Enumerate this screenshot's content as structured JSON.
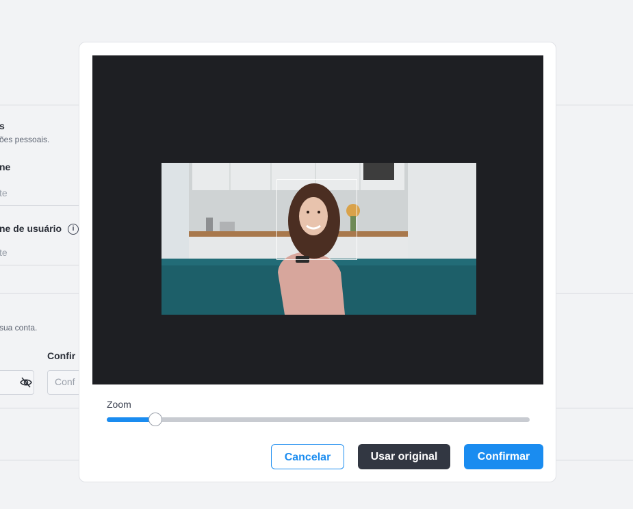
{
  "background": {
    "section1": {
      "title": "s",
      "subtitle": "ões pessoais."
    },
    "name_field": {
      "label": "ne",
      "value": "te"
    },
    "username_field": {
      "label": "ne de usuário",
      "value": "te",
      "info_icon": "i"
    },
    "section2": {
      "subtitle": "sua conta."
    },
    "confirm_field": {
      "label": "Confir",
      "placeholder": "Conf"
    },
    "icons": {
      "password_toggle": "eye-off-icon",
      "info": "info-icon"
    }
  },
  "modal": {
    "zoom_label": "Zoom",
    "zoom_level": 0.115,
    "buttons": {
      "cancel": "Cancelar",
      "use_original": "Usar original",
      "confirm": "Confirmar"
    }
  },
  "colors": {
    "accent": "#1a8cf0",
    "dark_button": "#323742",
    "crop_background": "#1e1f23"
  }
}
